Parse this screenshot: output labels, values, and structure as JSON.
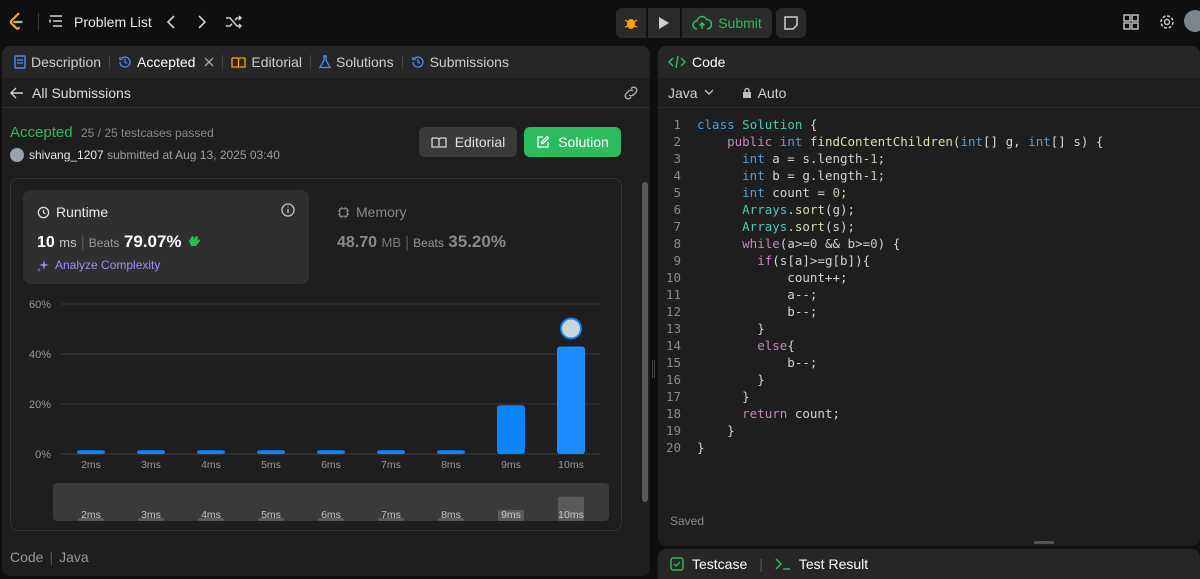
{
  "topbar": {
    "problem_list": "Problem List",
    "submit": "Submit"
  },
  "left_tabs": [
    {
      "label": "Description"
    },
    {
      "label": "Accepted"
    },
    {
      "label": "Editorial"
    },
    {
      "label": "Solutions"
    },
    {
      "label": "Submissions"
    }
  ],
  "back_label": "All Submissions",
  "result": {
    "status": "Accepted",
    "testcases": "25 / 25 testcases passed",
    "user": "shivang_1207",
    "submitted_at": "submitted at Aug 13, 2025 03:40",
    "editorial_btn": "Editorial",
    "solution_btn": "Solution"
  },
  "runtime": {
    "title": "Runtime",
    "value": "10",
    "unit": "ms",
    "beats_label": "Beats",
    "beats_pct": "79.07%",
    "analyze": "Analyze Complexity"
  },
  "memory": {
    "title": "Memory",
    "value": "48.70",
    "unit": "MB",
    "beats_label": "Beats",
    "beats_pct": "35.20%"
  },
  "chart_data": {
    "type": "bar",
    "categories": [
      "2ms",
      "3ms",
      "4ms",
      "5ms",
      "6ms",
      "7ms",
      "8ms",
      "9ms",
      "10ms"
    ],
    "values": [
      1.5,
      1.5,
      1.5,
      1.5,
      1.5,
      1.5,
      1.5,
      19.5,
      43
    ],
    "yticks": [
      "0%",
      "20%",
      "40%",
      "60%"
    ],
    "ylim": [
      0,
      60
    ],
    "highlight": "10ms",
    "bar_color": "#0a84ff"
  },
  "minimap": {
    "labels": [
      "2ms",
      "3ms",
      "4ms",
      "5ms",
      "6ms",
      "7ms",
      "8ms",
      "9ms",
      "10ms"
    ]
  },
  "footer": {
    "code": "Code",
    "lang": "Java"
  },
  "editor": {
    "tab": "Code",
    "language": "Java",
    "mode": "Auto",
    "saved": "Saved"
  },
  "code_lines": [
    "class Solution {",
    "    public int findContentChildren(int[] g, int[] s) {",
    "      int a = s.length-1;",
    "      int b = g.length-1;",
    "      int count = 0;",
    "      Arrays.sort(g);",
    "      Arrays.sort(s);",
    "      while(a>=0 && b>=0) {",
    "        if(s[a]>=g[b]){",
    "            count++;",
    "            a--;",
    "            b--;",
    "        }",
    "        else{",
    "            b--;",
    "        }",
    "      }",
    "      return count;",
    "    }",
    "}"
  ],
  "bottom_tabs": {
    "testcase": "Testcase",
    "result": "Test Result"
  }
}
